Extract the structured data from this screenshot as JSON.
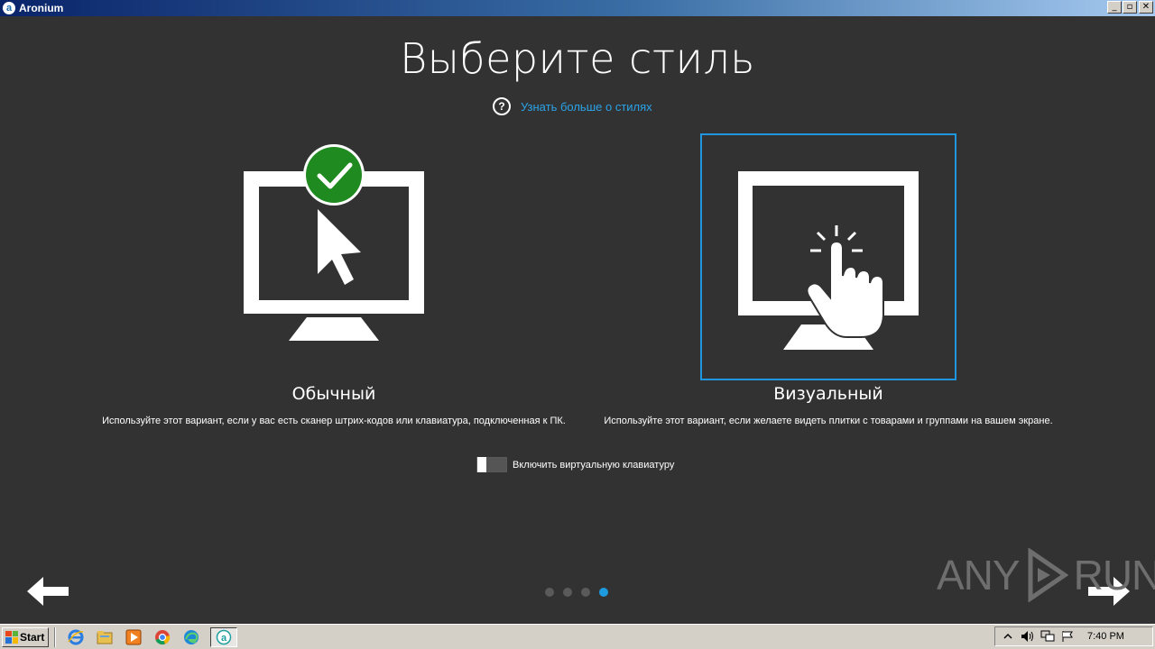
{
  "window": {
    "title": "Aronium",
    "app_icon_glyph": "a",
    "minimize": "_",
    "maximize": "▫",
    "close": "✕"
  },
  "page": {
    "title": "Выберите стиль",
    "help_link": "Узнать больше о стилях",
    "help_icon_glyph": "?"
  },
  "options": [
    {
      "label": "Обычный",
      "description": "Используйте этот вариант, если у вас есть сканер штрих-кодов или клавиатура, подключенная к ПК.",
      "icon": "monitor-pointer-icon",
      "checked": true
    },
    {
      "label": "Визуальный",
      "description": "Используйте этот вариант, если желаете видеть плитки с товарами и группами на вашем экране.",
      "icon": "monitor-touch-icon",
      "selected_focus": true
    }
  ],
  "virtual_keyboard": {
    "label": "Включить виртуальную клавиатуру",
    "enabled": false
  },
  "pagination": {
    "total": 4,
    "current": 4
  },
  "watermark": {
    "left": "ANY",
    "right": "RUN"
  },
  "taskbar": {
    "start_label": "Start",
    "pinned": [
      "ie-icon",
      "explorer-icon",
      "media-player-icon",
      "chrome-icon",
      "edge-icon",
      "aronium-icon"
    ],
    "tray_icons": [
      "chevron-up-icon",
      "volume-icon",
      "network-icon",
      "flag-icon"
    ],
    "clock": "7:40 PM"
  },
  "colors": {
    "accent": "#2196e0",
    "check": "#1f8a1f",
    "background": "#323232"
  }
}
